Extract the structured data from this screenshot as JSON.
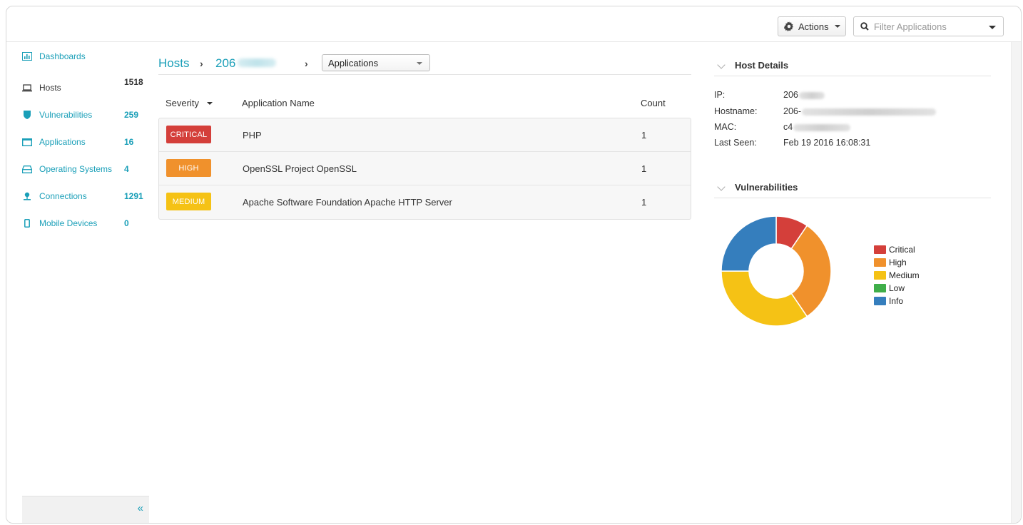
{
  "toolbar": {
    "actions_label": "Actions",
    "filter_placeholder": "Filter Applications"
  },
  "sidebar": {
    "items": [
      {
        "label": "Dashboards",
        "count": "",
        "icon": "bar-chart-icon"
      },
      {
        "label": "Hosts",
        "count": "1518",
        "icon": "laptop-icon"
      },
      {
        "label": "Vulnerabilities",
        "count": "259",
        "icon": "shield-icon"
      },
      {
        "label": "Applications",
        "count": "16",
        "icon": "window-icon"
      },
      {
        "label": "Operating Systems",
        "count": "4",
        "icon": "hard-drive-icon"
      },
      {
        "label": "Connections",
        "count": "1291",
        "icon": "network-icon"
      },
      {
        "label": "Mobile Devices",
        "count": "0",
        "icon": "mobile-icon"
      }
    ],
    "collapse_label": "«"
  },
  "breadcrumb": {
    "root": "Hosts",
    "separator": "›",
    "ip_prefix": "206",
    "view_select": "Applications"
  },
  "table": {
    "columns": {
      "severity": "Severity",
      "name": "Application Name",
      "count": "Count"
    },
    "rows": [
      {
        "severity": "CRITICAL",
        "severity_color": "#d43f3a",
        "name": "PHP",
        "count": "1"
      },
      {
        "severity": "HIGH",
        "severity_color": "#f0912c",
        "name": "OpenSSL Project OpenSSL",
        "count": "1"
      },
      {
        "severity": "MEDIUM",
        "severity_color": "#f5c215",
        "name": "Apache Software Foundation Apache HTTP Server",
        "count": "1"
      }
    ]
  },
  "host_details": {
    "title": "Host Details",
    "ip_label": "IP:",
    "ip_value": "206",
    "hostname_label": "Hostname:",
    "hostname_value": "206-",
    "mac_label": "MAC:",
    "mac_value": "c4",
    "last_seen_label": "Last Seen:",
    "last_seen_value": "Feb 19 2016 16:08:31"
  },
  "vulnerabilities_panel": {
    "title": "Vulnerabilities",
    "legend": [
      {
        "label": "Critical",
        "color": "#d43f3a"
      },
      {
        "label": "High",
        "color": "#f0912c"
      },
      {
        "label": "Medium",
        "color": "#f5c215"
      },
      {
        "label": "Low",
        "color": "#3fae49"
      },
      {
        "label": "Info",
        "color": "#357ebd"
      }
    ],
    "donut_fractions": {
      "critical": 0.095,
      "high": 0.31,
      "medium": 0.345,
      "low": 0,
      "info": 0.25
    }
  }
}
